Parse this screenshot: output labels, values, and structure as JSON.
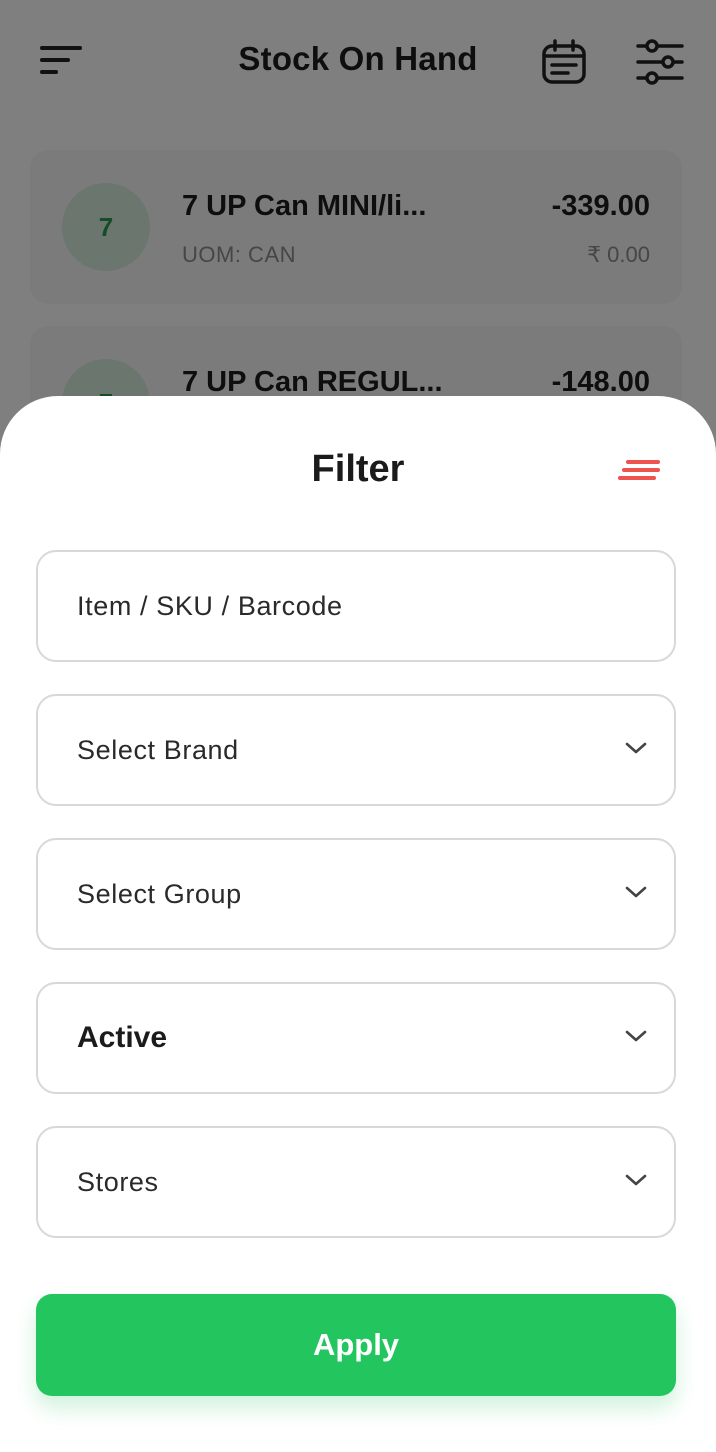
{
  "app_bar": {
    "title": "Stock On Hand",
    "icons": [
      "menu-icon",
      "calendar-icon",
      "tune-icon"
    ]
  },
  "stock_items": [
    {
      "initial": "7",
      "name": "7 UP Can MINI/li...",
      "uom": "UOM: CAN",
      "quantity": "-339.00",
      "price": "₹ 0.00"
    },
    {
      "initial": "7",
      "name": "7 UP Can REGUL...",
      "quantity": "-148.00"
    }
  ],
  "filter_sheet": {
    "title": "Filter",
    "clear_icon": "clear-filter-icon",
    "search_placeholder": "Item / SKU / Barcode",
    "brand_placeholder": "Select Brand",
    "group_placeholder": "Select Group",
    "status_value": "Active",
    "stores_placeholder": "Stores",
    "apply_label": "Apply"
  },
  "colors": {
    "accent_green": "#23c55e",
    "clear_icon_red": "#ef5350",
    "avatar_bg": "#d6ecdc",
    "avatar_text": "#2d9a52"
  }
}
